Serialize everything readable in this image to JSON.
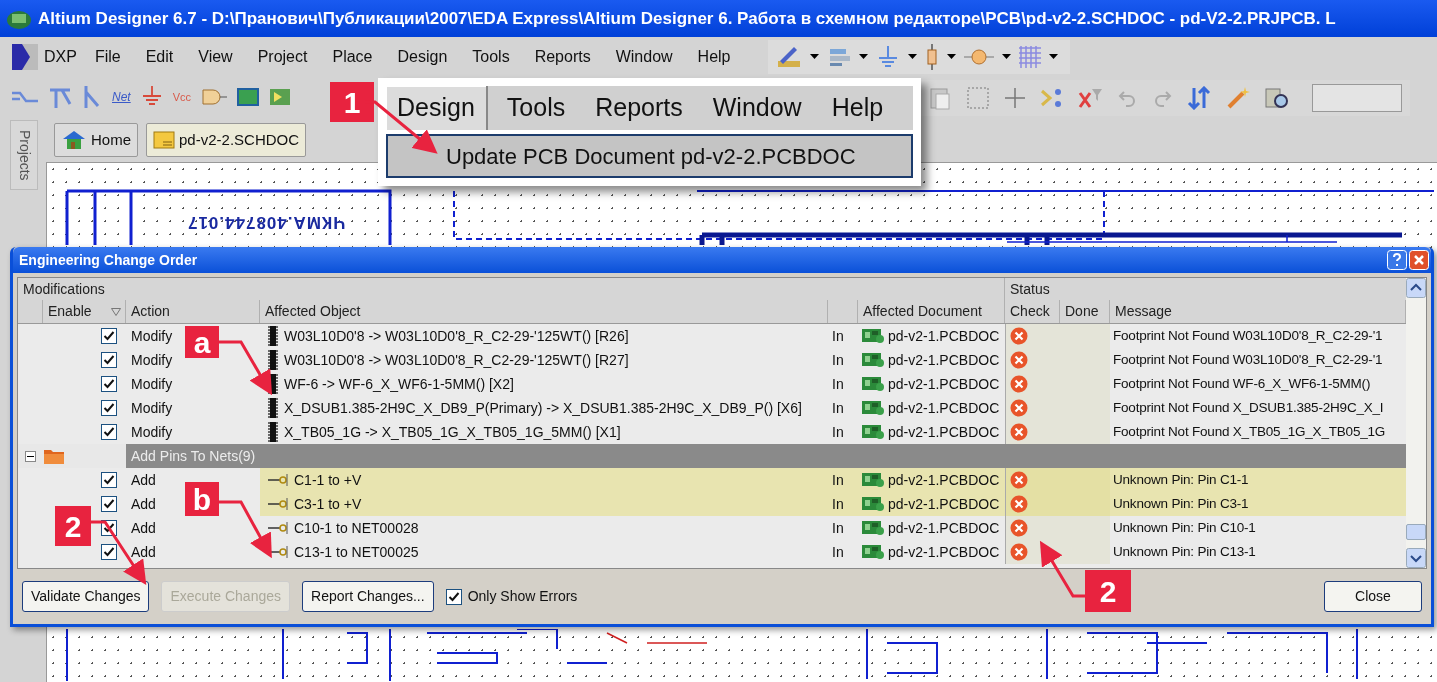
{
  "window": {
    "title": "Altium Designer 6.7 - D:\\Пранович\\Публикации\\2007\\EDA Express\\Altium Designer 6. Работа в схемном редакторе\\PCB\\pd-v2-2.SCHDOC - pd-V2-2.PRJPCB. L"
  },
  "menu": [
    {
      "label": "DXP"
    },
    {
      "label": "File"
    },
    {
      "label": "Edit"
    },
    {
      "label": "View"
    },
    {
      "label": "Project"
    },
    {
      "label": "Place"
    },
    {
      "label": "Design"
    },
    {
      "label": "Tools"
    },
    {
      "label": "Reports"
    },
    {
      "label": "Window"
    },
    {
      "label": "Help"
    }
  ],
  "toolbar": {
    "net_label": "Net",
    "power_port": "Vcc"
  },
  "projects_panel": {
    "label": "Projects"
  },
  "tabs": [
    {
      "label": "Home",
      "kind": "home",
      "selected": false
    },
    {
      "label": "pd-v2-2.SCHDOC",
      "kind": "schematic",
      "selected": true
    }
  ],
  "schematic": {
    "title_block_text": "ЧКМА.408744.017"
  },
  "popup_menu": {
    "bar": [
      {
        "label": "Design",
        "selected": true
      },
      {
        "label": "Tools",
        "selected": false
      },
      {
        "label": "Reports",
        "selected": false
      },
      {
        "label": "Window",
        "selected": false
      },
      {
        "label": "Help",
        "selected": false
      }
    ],
    "items": [
      {
        "label": "Update PCB Document pd-v2-2.PCBDOC",
        "selected": true
      }
    ]
  },
  "dialog": {
    "title": "Engineering Change Order",
    "group_headers": [
      "Modifications",
      "Status"
    ],
    "columns": [
      "Enable",
      "Action",
      "Affected Object",
      "Affected Document",
      "Check",
      "Done",
      "Message"
    ],
    "rows": [
      {
        "kind": "component",
        "checked": true,
        "action": "Modify",
        "object": "W03L10D0'8 -> W03L10D0'8_R_C2-29-'125WT() [R26]",
        "direction": "In",
        "document": "pd-v2-1.PCBDOC",
        "check_error": true,
        "message": "Footprint Not Found W03L10D0'8_R_C2-29-'1",
        "selected": false
      },
      {
        "kind": "component",
        "checked": true,
        "action": "Modify",
        "object": "W03L10D0'8 -> W03L10D0'8_R_C2-29-'125WT() [R27]",
        "direction": "In",
        "document": "pd-v2-1.PCBDOC",
        "check_error": true,
        "message": "Footprint Not Found W03L10D0'8_R_C2-29-'1",
        "selected": false
      },
      {
        "kind": "component",
        "checked": true,
        "action": "Modify",
        "object": "WF-6 -> WF-6_X_WF6-1-5MM() [X2]",
        "direction": "In",
        "document": "pd-v2-1.PCBDOC",
        "check_error": true,
        "message": "Footprint Not Found WF-6_X_WF6-1-5MM()",
        "selected": false
      },
      {
        "kind": "component",
        "checked": true,
        "action": "Modify",
        "object": "X_DSUB1.385-2H9C_X_DB9_P(Primary) -> X_DSUB1.385-2H9C_X_DB9_P() [X6]",
        "direction": "In",
        "document": "pd-v2-1.PCBDOC",
        "check_error": true,
        "message": "Footprint Not Found X_DSUB1.385-2H9C_X_I",
        "selected": false
      },
      {
        "kind": "component",
        "checked": true,
        "action": "Modify",
        "object": "X_TB05_1G -> X_TB05_1G_X_TB05_1G_5MM() [X1]",
        "direction": "In",
        "document": "pd-v2-1.PCBDOC",
        "check_error": true,
        "message": "Footprint Not Found X_TB05_1G_X_TB05_1G",
        "selected": false
      },
      {
        "kind": "group",
        "expanded": true,
        "label": "Add Pins To Nets(9)"
      },
      {
        "kind": "pin",
        "checked": true,
        "action": "Add",
        "object": "C1-1 to +V",
        "direction": "In",
        "document": "pd-v2-1.PCBDOC",
        "check_error": true,
        "message": "Unknown Pin: Pin C1-1",
        "selected": true
      },
      {
        "kind": "pin",
        "checked": true,
        "action": "Add",
        "object": "C3-1 to +V",
        "direction": "In",
        "document": "pd-v2-1.PCBDOC",
        "check_error": true,
        "message": "Unknown Pin: Pin C3-1",
        "selected": true
      },
      {
        "kind": "pin",
        "checked": true,
        "action": "Add",
        "object": "C10-1 to NET00028",
        "direction": "In",
        "document": "pd-v2-1.PCBDOC",
        "check_error": true,
        "message": "Unknown Pin: Pin C10-1",
        "selected": false
      },
      {
        "kind": "pin",
        "checked": true,
        "action": "Add",
        "object": "C13-1 to NET00025",
        "direction": "In",
        "document": "pd-v2-1.PCBDOC",
        "check_error": true,
        "message": "Unknown Pin: Pin C13-1",
        "selected": false
      }
    ],
    "buttons": [
      {
        "label": "Validate Changes",
        "disabled": false
      },
      {
        "label": "Execute Changes",
        "disabled": true
      },
      {
        "label": "Report Changes...",
        "disabled": false
      }
    ],
    "only_show_errors": {
      "label": "Only Show Errors",
      "checked": true
    },
    "close_button": "Close"
  },
  "callouts": [
    {
      "label": "1"
    },
    {
      "label": "a"
    },
    {
      "label": "b"
    },
    {
      "label": "2"
    },
    {
      "label": "2"
    }
  ]
}
